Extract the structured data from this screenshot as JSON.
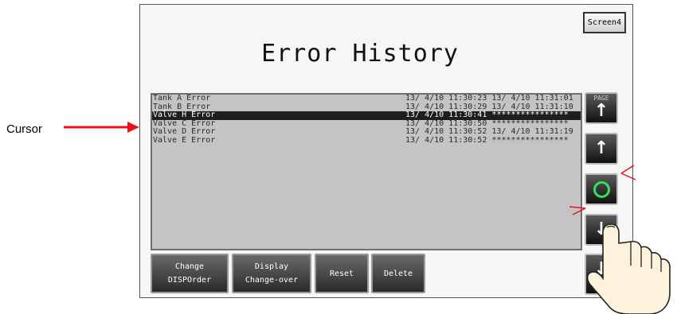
{
  "annotation": {
    "cursor_label": "Cursor"
  },
  "screen": {
    "screen_button": "Screen4",
    "title": "Error History",
    "list": {
      "rows": [
        {
          "name": "Tank A Error",
          "times": "13/ 4/10 11:30:23 13/ 4/10 11:31:01",
          "selected": false
        },
        {
          "name": "Tank B Error",
          "times": "13/ 4/10 11:30:29 13/ 4/10 11:31:10",
          "selected": false
        },
        {
          "name": "Valve H Error",
          "times": "13/ 4/10 11:30:41 ****************",
          "selected": true
        },
        {
          "name": "Valve C Error",
          "times": "13/ 4/10 11:30:50 ****************",
          "selected": false
        },
        {
          "name": "Valve D Error",
          "times": "13/ 4/10 11:30:52 13/ 4/10 11:31:19",
          "selected": false
        },
        {
          "name": "Valve E Error",
          "times": "13/ 4/10 11:30:52 ****************",
          "selected": false
        }
      ]
    },
    "side_buttons": {
      "page_up_label": "PAGE",
      "page_up_icon": "arrow-up-icon",
      "up_icon": "arrow-up-icon",
      "ok_icon": "green-circle-icon",
      "down_icon": "arrow-down-icon",
      "page_down_icon": "arrow-down-icon",
      "page_down_label": "PAGE"
    },
    "bottom_buttons": {
      "change_order_line1": "Change",
      "change_order_line2": "DISPOrder",
      "display_change_line1": "Display",
      "display_change_line2": "Change-over",
      "reset": "Reset",
      "delete": "Delete"
    },
    "colors": {
      "annotation_arrow": "#e8141b",
      "ok_green": "#39e05a",
      "selected_row": "#1e1e1e",
      "list_bg": "#c4c4c4"
    }
  }
}
